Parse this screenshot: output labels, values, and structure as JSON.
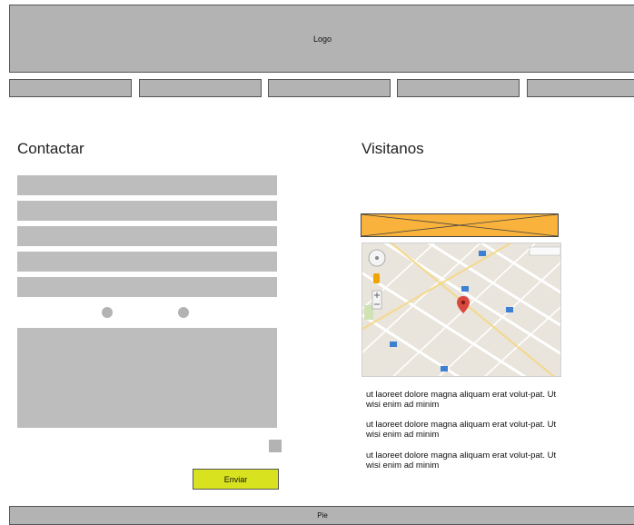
{
  "header": {
    "logo": "Logo"
  },
  "nav": {
    "items": [
      "",
      "",
      "",
      "",
      ""
    ]
  },
  "contact": {
    "title": "Contactar",
    "submit_label": "Enviar"
  },
  "visit": {
    "title": "Visitanos",
    "paragraphs": [
      "ut laoreet dolore magna aliquam erat volut-pat. Ut wisi enim ad minim",
      "ut laoreet dolore magna aliquam erat volut-pat. Ut wisi enim ad minim",
      "ut laoreet dolore magna aliquam erat volut-pat. Ut wisi enim ad minim"
    ]
  },
  "footer": {
    "label": "Pie"
  },
  "colors": {
    "placeholder": "#b3b3b3",
    "button": "#d8e21e",
    "banner": "#f9b23b"
  }
}
